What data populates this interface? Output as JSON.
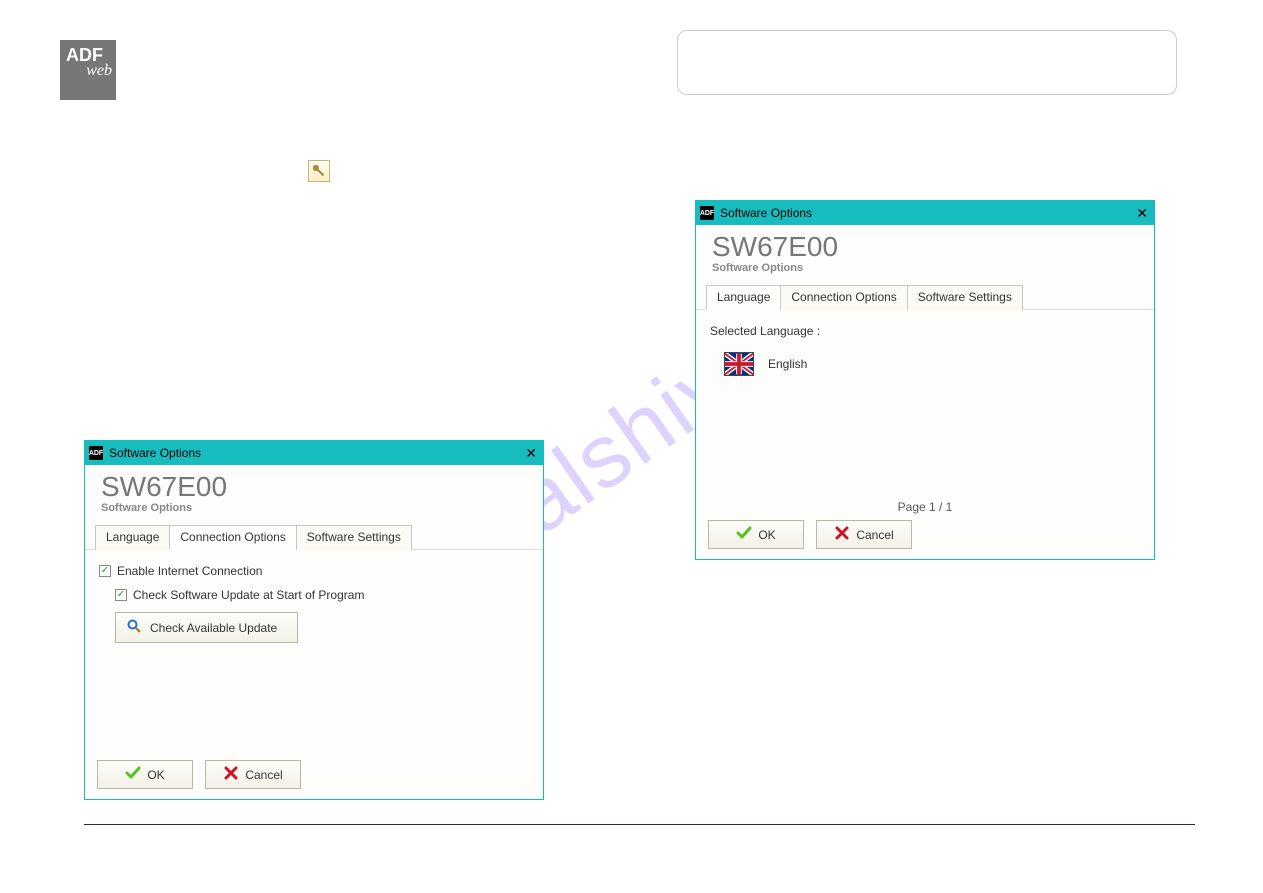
{
  "logo": {
    "line1": "ADF",
    "line2": "web"
  },
  "watermark_text": "manualshive.com",
  "dialog_title": "Software Options",
  "h_title": "SW67E00",
  "h_sub": "Software Options",
  "tabs": {
    "lang": "Language",
    "conn": "Connection Options",
    "soft": "Software Settings"
  },
  "d1": {
    "enable_internet": "Enable Internet Connection",
    "check_start": "Check Software Update at Start of Program",
    "check_btn": "Check Available Update"
  },
  "d2": {
    "selected_lang_label": "Selected Language :",
    "english": "English",
    "page_of": "Page 1 / 1"
  },
  "buttons": {
    "ok": "OK",
    "cancel": "Cancel"
  }
}
